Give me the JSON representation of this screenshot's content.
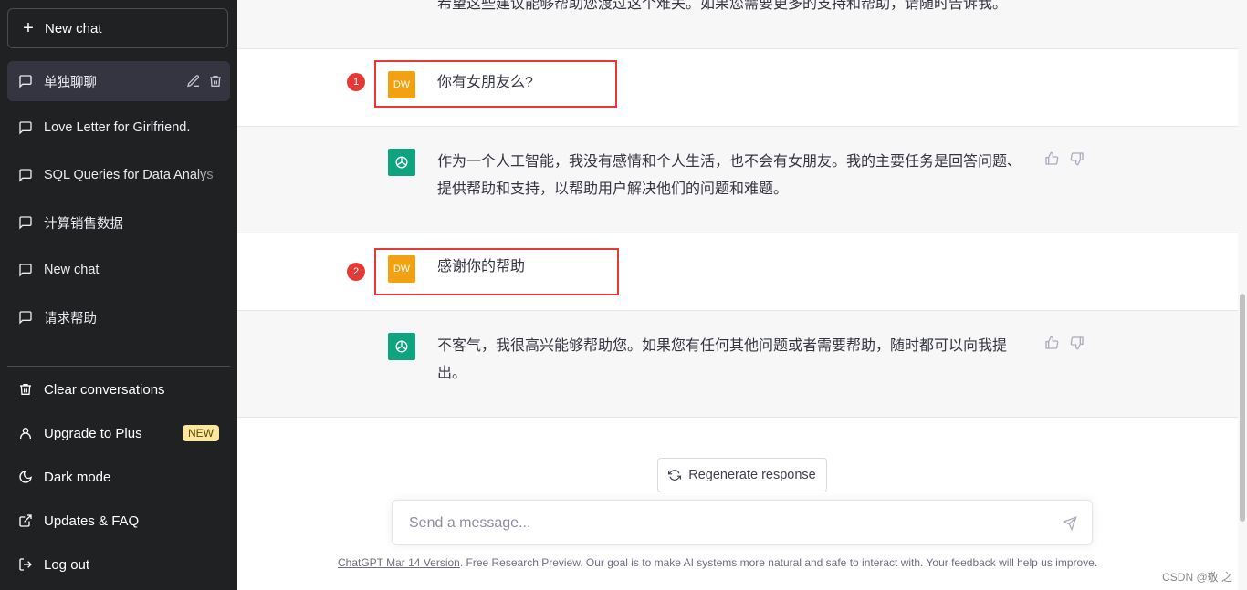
{
  "sidebar": {
    "new_chat_label": "New chat",
    "conversations": [
      {
        "label": "单独聊聊",
        "active": true
      },
      {
        "label": "Love Letter for Girlfriend."
      },
      {
        "label": "SQL Queries for Data Analys"
      },
      {
        "label": "计算销售数据"
      },
      {
        "label": "New chat"
      },
      {
        "label": "请求帮助"
      }
    ],
    "bottom_menu": [
      {
        "label": "Clear conversations",
        "icon": "trash-icon"
      },
      {
        "label": "Upgrade to Plus",
        "icon": "user-icon",
        "badge": "NEW"
      },
      {
        "label": "Dark mode",
        "icon": "moon-icon"
      },
      {
        "label": "Updates & FAQ",
        "icon": "external-link-icon"
      },
      {
        "label": "Log out",
        "icon": "logout-icon"
      }
    ]
  },
  "chat": {
    "top_partial_text": "希望这些建议能够帮助您渡过这个难关。如果您需要更多的支持和帮助，请随时告诉我。",
    "messages": [
      {
        "role": "user",
        "avatar": "DW",
        "text": "你有女朋友么?",
        "marker": "1"
      },
      {
        "role": "assistant",
        "text": "作为一个人工智能，我没有感情和个人生活，也不会有女朋友。我的主要任务是回答问题、提供帮助和支持，以帮助用户解决他们的问题和难题。"
      },
      {
        "role": "user",
        "avatar": "DW",
        "text": "感谢你的帮助",
        "marker": "2"
      },
      {
        "role": "assistant",
        "text": "不客气，我很高兴能够帮助您。如果您有任何其他问题或者需要帮助，随时都可以向我提出。"
      }
    ],
    "regenerate_label": "Regenerate response",
    "input_placeholder": "Send a message...",
    "footer_link": "ChatGPT Mar 14 Version",
    "footer_text": ". Free Research Preview. Our goal is to make AI systems more natural and safe to interact with. Your feedback will help us improve.",
    "watermark": "CSDN @敬 之"
  },
  "colors": {
    "sidebar_bg": "#202123",
    "user_avatar": "#f2a112",
    "assistant_avatar": "#10a37f",
    "highlight": "#e53935",
    "badge_bg": "#fae69e"
  }
}
